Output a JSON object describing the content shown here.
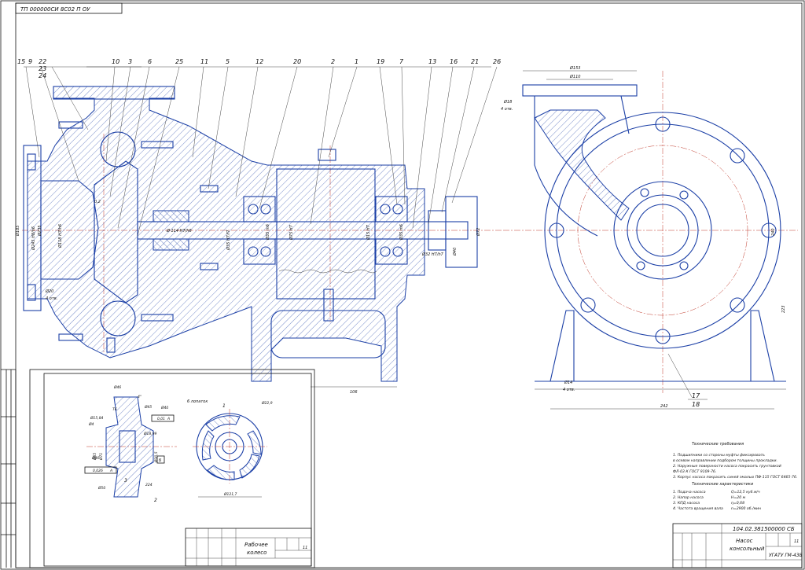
{
  "stamp_top": "ТП 000000СИ 8С02 П ОУ",
  "main_view": {
    "position_labels": [
      "15",
      "9",
      "22",
      "23",
      "24",
      "10",
      "3",
      "6",
      "25",
      "11",
      "5",
      "12",
      "20",
      "2",
      "1",
      "19",
      "7",
      "13",
      "16",
      "21",
      "26"
    ],
    "dimensions": [
      "Ø185",
      "Ø245 Н8/h6",
      "Ø235",
      "Ø118 Н7/h6",
      "Ø20",
      "4 отв.",
      "0,2",
      "Ø 114 Н7/h6",
      "Ø35 Н7/f7",
      "Ø35 m6",
      "Ø75 Н7",
      "Ø15 Н7",
      "Ø35 m6",
      "Ø32 Н7/h7",
      "Ø72",
      "106",
      "Ø40"
    ],
    "bottom_labels": [
      "17",
      "18"
    ]
  },
  "side_view": {
    "dimensions": [
      "Ø153",
      "Ø110",
      "Ø18",
      "4 отв.",
      "240",
      "223",
      "Ø14",
      "4 отв.",
      "242"
    ]
  },
  "detail": {
    "dimensions": [
      "Ø46",
      "4°",
      "Ø45",
      "Т6",
      "Ø15,84",
      "Ø18,99",
      "Ø40",
      "0,01",
      "А",
      "Ø4",
      "Ø65",
      "Ø71",
      "Ø30,5",
      "Ø46",
      "3",
      "0,026",
      "А",
      "2",
      "Ø50",
      "224",
      "Б",
      "6 лопаток",
      "1",
      "Ø22,9",
      "Ø121,7"
    ],
    "title_block": {
      "name_line1": "Рабочее",
      "name_line2": "колесо",
      "sheet": "11"
    }
  },
  "requirements": {
    "heading": "Технические требования",
    "items": [
      "1. Подшипники со стороны муфты фиксировать",
      "в осевом направлении подбором толщины прокладки.",
      "2. Наружные поверхности насоса покрасить грунтовкой",
      "ФЛ-03 К ГОСТ 9109-76.",
      "3. Корпус насоса покрасить синей эмалью ПФ-115 ГОСТ 6465-76."
    ],
    "characteristics_heading": "Технические характеристики",
    "characteristics": [
      {
        "label": "1. Подача насоса",
        "value": "Q=12,5 куб.м/ч"
      },
      {
        "label": "2. Напор насоса",
        "value": "Н=20 м"
      },
      {
        "label": "3. КПД насоса",
        "value": "η=0,68"
      },
      {
        "label": "4. Частота вращения вала",
        "value": "n=2900 об./мин"
      }
    ]
  },
  "title_block": {
    "code": "104.02.381500000 СБ",
    "name_line1": "Насос",
    "name_line2": "консольный",
    "sheet": "11",
    "org": "УГАТУ ГМ-438"
  },
  "colors": {
    "line": "#1b3fa6",
    "center": "#c0392b",
    "ink": "#111111"
  }
}
